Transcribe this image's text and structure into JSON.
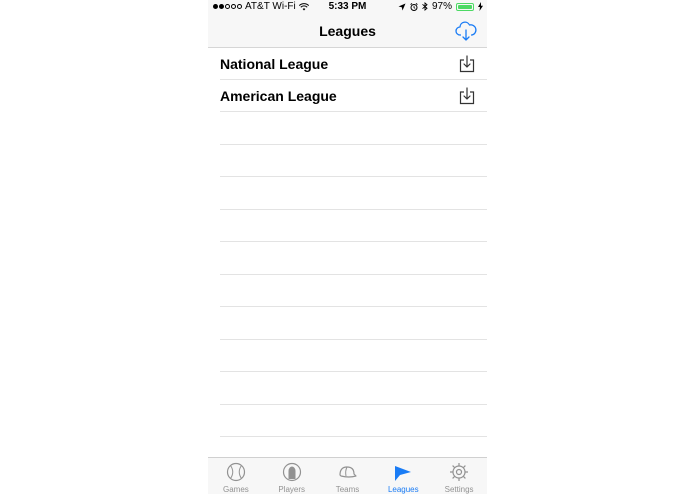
{
  "status_bar": {
    "carrier": "AT&T Wi-Fi",
    "time": "5:33 PM",
    "battery_percent": "97%",
    "battery_level": 0.97,
    "signal_bars_filled": 2,
    "signal_bars_total": 5
  },
  "nav": {
    "title": "Leagues",
    "action_icon": "cloud-download-icon"
  },
  "leagues": [
    {
      "name": "National League",
      "action_icon": "download-icon"
    },
    {
      "name": "American League",
      "action_icon": "download-icon"
    }
  ],
  "tab_bar": {
    "active_tab": "Leagues",
    "tabs": [
      {
        "label": "Games",
        "icon": "baseball-icon"
      },
      {
        "label": "Players",
        "icon": "player-icon"
      },
      {
        "label": "Teams",
        "icon": "cap-icon"
      },
      {
        "label": "Leagues",
        "icon": "flag-icon"
      },
      {
        "label": "Settings",
        "icon": "gear-icon"
      }
    ]
  },
  "colors": {
    "accent": "#1a7cf5",
    "inactive": "#929292",
    "battery": "#4cd964"
  }
}
